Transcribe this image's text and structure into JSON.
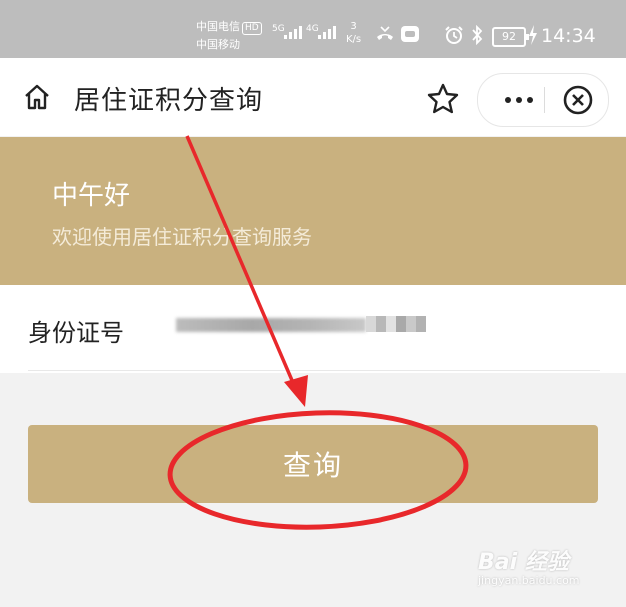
{
  "status_bar": {
    "carrier_1": "中国电信",
    "carrier_1_badge": "HD",
    "carrier_2": "中国移动",
    "network_1": "5G",
    "network_2": "4G",
    "speed_value": "3",
    "speed_unit": "K/s",
    "battery": "92",
    "time": "14:34",
    "icons": [
      "missed-call-icon",
      "app-notification-icon",
      "alarm-icon",
      "bluetooth-icon",
      "charging-icon"
    ]
  },
  "title_bar": {
    "title": "居住证积分查询",
    "icons": [
      "home-icon",
      "star-icon",
      "more-icon",
      "close-circle-icon"
    ]
  },
  "banner": {
    "greeting": "中午好",
    "welcome": "欢迎使用居住证积分查询服务"
  },
  "form": {
    "id_label": "身份证号",
    "id_value_obscured": true
  },
  "query_button": {
    "label": "查询"
  },
  "annotation": {
    "color": "#e8282b",
    "shapes": [
      "arrow",
      "ellipse"
    ]
  },
  "watermark": {
    "brand": "Bai 经验",
    "url": "jingyan.baidu.com"
  },
  "colors": {
    "status_bar": "#bdbdbd",
    "accent": "#c9b17f",
    "page_bg": "#f2f2f2",
    "annotation": "#e8282b"
  }
}
